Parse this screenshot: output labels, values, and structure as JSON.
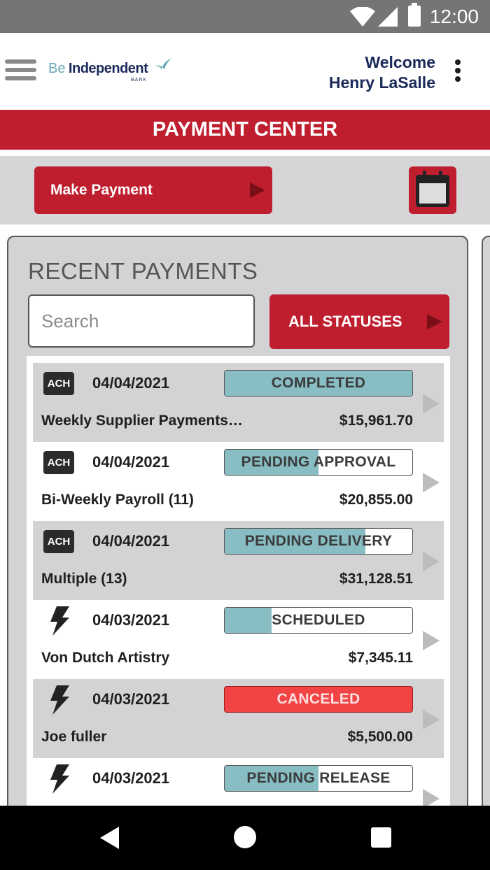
{
  "status_bar": {
    "time": "12:00"
  },
  "header": {
    "logo": {
      "be": "Be",
      "independent": "Independent",
      "bank": "BANK"
    },
    "welcome_line1": "Welcome",
    "welcome_line2": "Henry LaSalle"
  },
  "title": "PAYMENT CENTER",
  "actions": {
    "make_payment_label": "Make Payment"
  },
  "recent": {
    "title": "RECENT PAYMENTS",
    "search_placeholder": "Search",
    "filter_label": "ALL STATUSES"
  },
  "payments": [
    {
      "type": "ACH",
      "date": "04/04/2021",
      "status": "COMPLETED",
      "progress": 1.0,
      "name": "Weekly Supplier Payments…",
      "amount": "$15,961.70"
    },
    {
      "type": "ACH",
      "date": "04/04/2021",
      "status": "PENDING APPROVAL",
      "progress": 0.5,
      "name": "Bi-Weekly Payroll (11)",
      "amount": "$20,855.00"
    },
    {
      "type": "ACH",
      "date": "04/04/2021",
      "status": "PENDING DELIVERY",
      "progress": 0.75,
      "name": "Multiple (13)",
      "amount": "$31,128.51"
    },
    {
      "type": "wire",
      "date": "04/03/2021",
      "status": "SCHEDULED",
      "progress": 0.25,
      "name": "Von Dutch Artistry",
      "amount": "$7,345.11"
    },
    {
      "type": "wire",
      "date": "04/03/2021",
      "status": "CANCELED",
      "progress": 1.0,
      "name": "Joe fuller",
      "amount": "$5,500.00"
    },
    {
      "type": "wire",
      "date": "04/03/2021",
      "status": "PENDING RELEASE",
      "progress": 0.5,
      "name": "",
      "amount": ""
    }
  ],
  "colors": {
    "brand_red": "#bf1e2e",
    "status_teal": "#87bdc3",
    "canceled_red": "#f24444",
    "navy": "#1a2a5a"
  },
  "icons": {
    "menu": "hamburger-icon",
    "more": "kebab-icon",
    "calendar": "calendar-icon",
    "ach": "ach-badge",
    "wire": "lightning-bolt-icon"
  }
}
